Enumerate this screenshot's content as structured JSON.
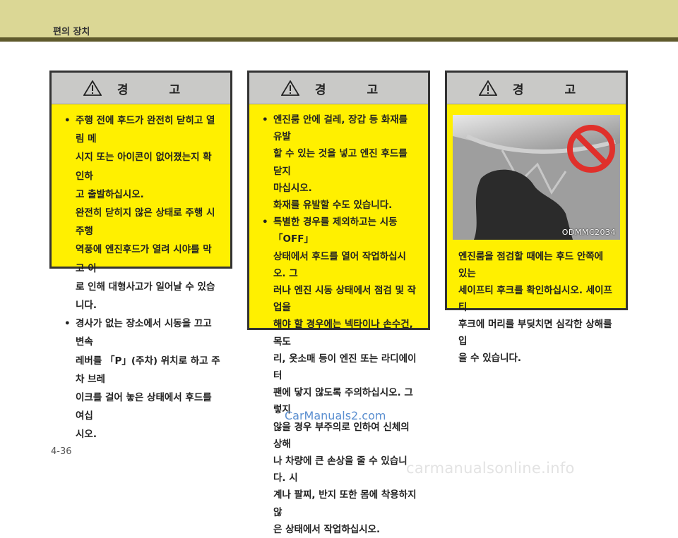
{
  "header": {
    "section_title": "편의 장치"
  },
  "warnings": [
    {
      "title": "경 고",
      "items": [
        {
          "lines": [
            "주행 전에 후드가 완전히 닫히고 열림 메",
            "시지 또는 아이콘이 없어졌는지 확인하",
            "고 출발하십시오."
          ],
          "extra_lines": [
            "완전히 닫히지 않은 상태로 주행 시 주행",
            "역풍에 엔진후드가 열려 시야를 막고 이",
            "로 인해 대형사고가 일어날 수 있습니다."
          ]
        },
        {
          "lines": [
            "경사가 없는 장소에서 시동을 끄고 변속",
            "레버를 「P」(주차) 위치로 하고 주차 브레",
            "이크를 걸어 놓은 상태에서 후드를 여십",
            "시오."
          ]
        }
      ]
    },
    {
      "title": "경 고",
      "items": [
        {
          "lines": [
            "엔진룸 안에 걸레, 장갑 등 화재를 유발",
            "할 수 있는 것을 넣고 엔진 후드를 닫지",
            "마십시오."
          ],
          "extra_lines": [
            "화재를 유발할 수도 있습니다."
          ]
        },
        {
          "lines": [
            "특별한 경우를 제외하고는 시동 「OFF」",
            "상태에서 후드를 열어 작업하십시오. 그",
            "러나 엔진 시동 상태에서 점검 및 작업을",
            "해야 할 경우에는 넥타이나 손수건, 목도",
            "리, 옷소매 등이 엔진 또는 라디에이터",
            "팬에 닿지 않도록 주의하십시오. 그렇지",
            "않을 경우 부주의로 인하여 신체의 상해",
            "나 차량에 큰 손상을 줄 수 있습니다. 시",
            "계나 팔찌, 반지 또한 몸에 착용하지 않",
            "은 상태에서 작업하십시오."
          ]
        }
      ]
    },
    {
      "title": "경 고",
      "image_code": "ODMMC2034",
      "caption_lines": [
        "엔진룸을 점검할 때에는 후드 안쪽에 있는",
        "세이프티 후크를 확인하십시오. 세이프티",
        "후크에 머리를 부딪치면 심각한 상해를 입",
        "을 수 있습니다."
      ]
    }
  ],
  "watermark": "CarManuals2.com",
  "page_number": "4-36",
  "footer_site": "carmanualsonline.info",
  "colors": {
    "header_bg": "#dbd795",
    "header_line": "#5f5a2c",
    "warning_bg": "#fff000",
    "warning_head": "#c9c9c7",
    "prohibit_red": "#e0302b"
  }
}
